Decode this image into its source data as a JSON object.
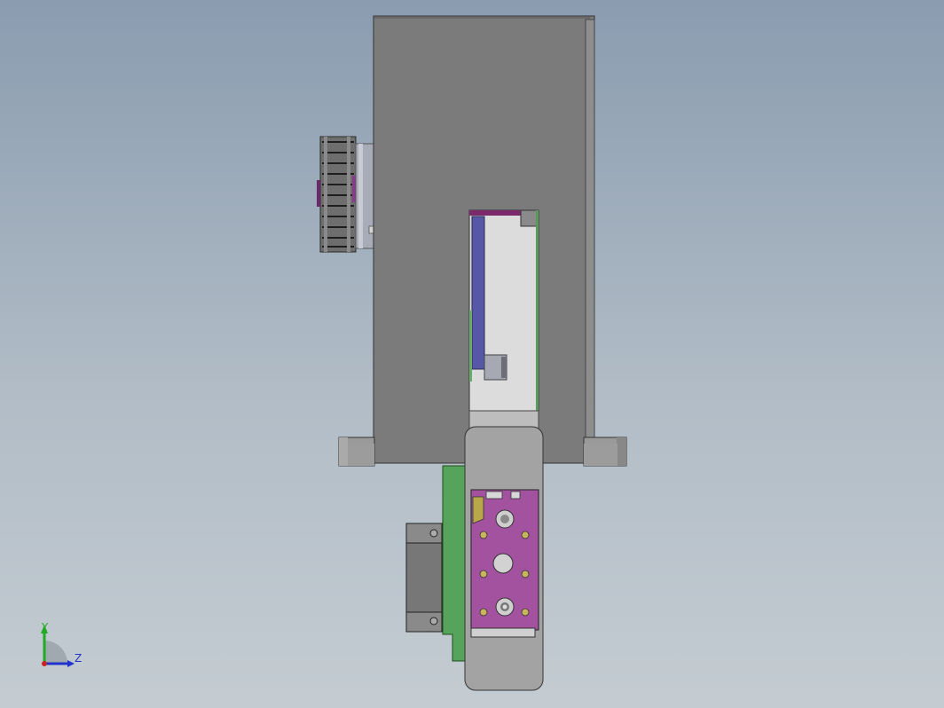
{
  "viewport": {
    "background_top": "#8a9cb0",
    "background_bottom": "#c4ccd2"
  },
  "model": {
    "housing_color": "#7a7a7a",
    "plate_color": "#9b4f9b",
    "pcb_color": "#4f9d52",
    "bracket_color": "#5a5aa8"
  },
  "triad": {
    "y_label": "Y",
    "z_label": "Z",
    "y_color": "#22aa22",
    "z_color": "#2233cc",
    "origin_color": "#cc2222"
  }
}
